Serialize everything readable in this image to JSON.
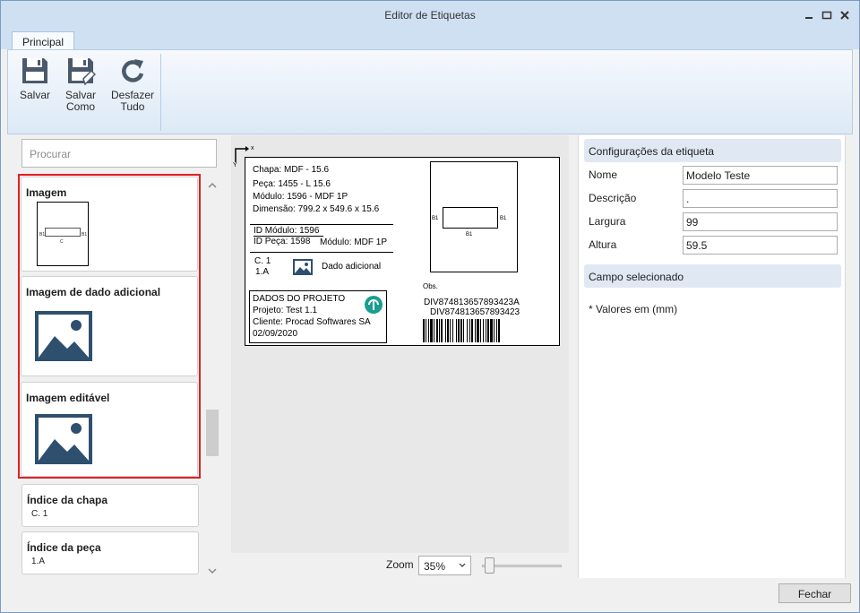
{
  "window": {
    "title": "Editor de Etiquetas"
  },
  "ribbon": {
    "tab": "Principal",
    "buttons": [
      {
        "label_1": "Salvar",
        "label_2": "",
        "icon": "floppy-disk-icon"
      },
      {
        "label_1": "Salvar",
        "label_2": "Como",
        "icon": "floppy-disk-pencil-icon"
      },
      {
        "label_1": "Desfazer",
        "label_2": "Tudo",
        "icon": "undo-icon"
      }
    ]
  },
  "left_panel": {
    "search_placeholder": "Procurar",
    "items": [
      {
        "title": "Imagem",
        "icon": "label-thumbnail-icon"
      },
      {
        "title": "Imagem de dado adicional",
        "icon": "picture-icon"
      },
      {
        "title": "Imagem editável",
        "icon": "picture-icon"
      },
      {
        "title": "Índice da chapa",
        "value": "C. 1"
      },
      {
        "title": "Índice da peça",
        "value": "1.A"
      }
    ],
    "thumb": {
      "left": "B1",
      "right": "B1",
      "bottom": "C"
    }
  },
  "label": {
    "axis_x": "x",
    "axis_y": "Y",
    "chapa": "Chapa: MDF - 15.6",
    "peca": "Peça: 1455 - L 15.6",
    "modulo": "Módulo: 1596 - MDF 1P",
    "dimensao": "Dimensão: 799.2 x 549.6 x 15.6",
    "id_modulo": "ID Módulo: 1596",
    "id_peca": "ID Peça: 1598",
    "modulo_short": "Módulo: MDF 1P",
    "chapa_index": "C. 1",
    "peca_index": "1.A",
    "dado_adicional": "Dado adicional",
    "edge_left": "B1",
    "edge_right": "B1",
    "edge_bottom": "B1",
    "obs": "Obs.",
    "code_1": "DIV874813657893423A",
    "code_2": "DIV874813657893423",
    "project_title": "DADOS DO PROJETO",
    "projeto": "Projeto: Test 1.1",
    "cliente": "Cliente: Procad Softwares SA",
    "data": "02/09/2020"
  },
  "zoom": {
    "label": "Zoom",
    "value": "35%",
    "slider_fraction": 0.1
  },
  "right_panel": {
    "section_config": "Configurações da etiqueta",
    "fields": [
      {
        "label": "Nome",
        "value": "Modelo Teste"
      },
      {
        "label": "Descrição",
        "value": "."
      },
      {
        "label": "Largura",
        "value": "99"
      },
      {
        "label": "Altura",
        "value": "59.5"
      }
    ],
    "section_selected": "Campo selecionado",
    "note": "* Valores em (mm)"
  },
  "footer": {
    "close": "Fechar"
  },
  "colors": {
    "highlight": "#e01f25",
    "accent": "#1a9e8f",
    "picture": "#2f4f6f"
  }
}
